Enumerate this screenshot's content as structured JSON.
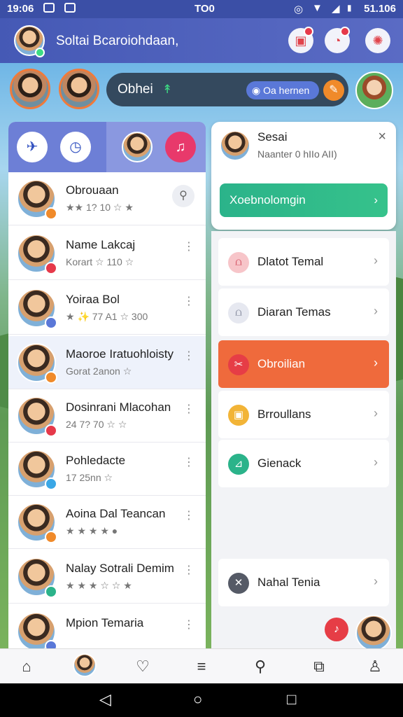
{
  "status": {
    "left": "19:06",
    "center": "TO0",
    "right": "51.106"
  },
  "header": {
    "title": "Soltai Bcaroiohdaan,",
    "badge_count": "1"
  },
  "story_search": {
    "label": "Obhei",
    "chip": "Oa hernen"
  },
  "contacts": [
    {
      "name": "Obrouaan",
      "sub": "★★ 1? 10 ☆ ★",
      "badge": "#f08a2a"
    },
    {
      "name": "Name Lakcaj",
      "sub": "Korart ☆ 110 ☆",
      "badge": "#e6394a"
    },
    {
      "name": "Yoiraa Bol",
      "sub": "★ ✨ 77 A1 ☆ 300",
      "badge": "#5a78d8"
    },
    {
      "name": "Maoroe Iratuohloisty",
      "sub": "Gorat 2anon ☆",
      "badge": "#f08a2a"
    },
    {
      "name": "Dosinrani Mlacohan",
      "sub": "24 7? 70 ☆ ☆",
      "badge": "#e6394a"
    },
    {
      "name": "Pohledacte",
      "sub": "17 25nn ☆",
      "badge": "#3aa7e6"
    },
    {
      "name": "Aoina Dal Teancan",
      "sub": "★ ★ ★ ★ ●",
      "badge": "#f08a2a"
    },
    {
      "name": "Nalay Sotrali Demim",
      "sub": "★ ★ ★ ☆ ☆ ★",
      "badge": "#2bb38a"
    },
    {
      "name": "Mpion Temaria",
      "sub": "",
      "badge": "#5a78d8"
    }
  ],
  "popup": {
    "name": "Sesai",
    "sub": "Naanter 0 hIIo AII)",
    "button": "Xoebnolomgin",
    "close": "×"
  },
  "menu": [
    {
      "label": "Dlatot Temal",
      "icon_color": "#f7c5c9",
      "glyph_color": "#d0485a",
      "active": false
    },
    {
      "label": "Diaran Temas",
      "icon_color": "#e6e8f0",
      "glyph_color": "#7a7f94",
      "active": false
    },
    {
      "label": "Obroilian",
      "icon_color": "#e63d46",
      "glyph_color": "#ffffff",
      "active": true
    },
    {
      "label": "Brroullans",
      "icon_color": "#f2b437",
      "glyph_color": "#ffffff",
      "active": false
    },
    {
      "label": "Gienack",
      "icon_color": "#2bb38a",
      "glyph_color": "#ffffff",
      "active": false
    },
    {
      "label": "Nahal Tenia",
      "icon_color": "#555a66",
      "glyph_color": "#ffffff",
      "active": false
    }
  ],
  "icons": {
    "status": "battery-icon",
    "nav": [
      "home-icon",
      "profile-icon",
      "heart-icon",
      "menu-icon",
      "search-icon",
      "camera-icon",
      "person-icon"
    ]
  },
  "colors": {
    "header": "#4559b5",
    "active_item": "#ef6a3c",
    "accent_green": "#2bb38a"
  }
}
